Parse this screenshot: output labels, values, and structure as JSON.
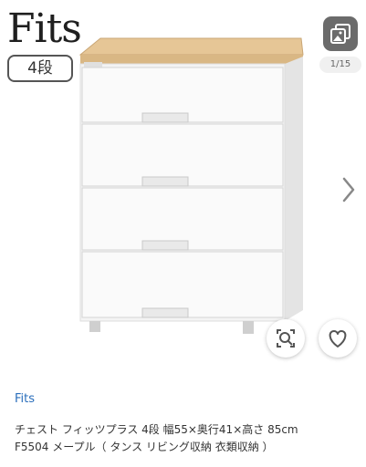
{
  "gallery": {
    "brand_logo_text": "Fits",
    "tier_badge": "4段",
    "photo_counter": "1/15",
    "icons": {
      "photos": "photo-gallery-icon",
      "next": "chevron-right-icon",
      "zoom": "zoom-icon",
      "favorite": "heart-icon"
    }
  },
  "product": {
    "brand": "Fits",
    "title_line1": "チェスト フィッツプラス 4段 幅55×奥行41×高さ 85cm",
    "title_line2": "F5504 メープル（ タンス リビング収納 衣類収納 ）"
  },
  "colors": {
    "link": "#2a6ebb",
    "top_panel": "#e8c898",
    "body_white": "#f7f7f7"
  }
}
